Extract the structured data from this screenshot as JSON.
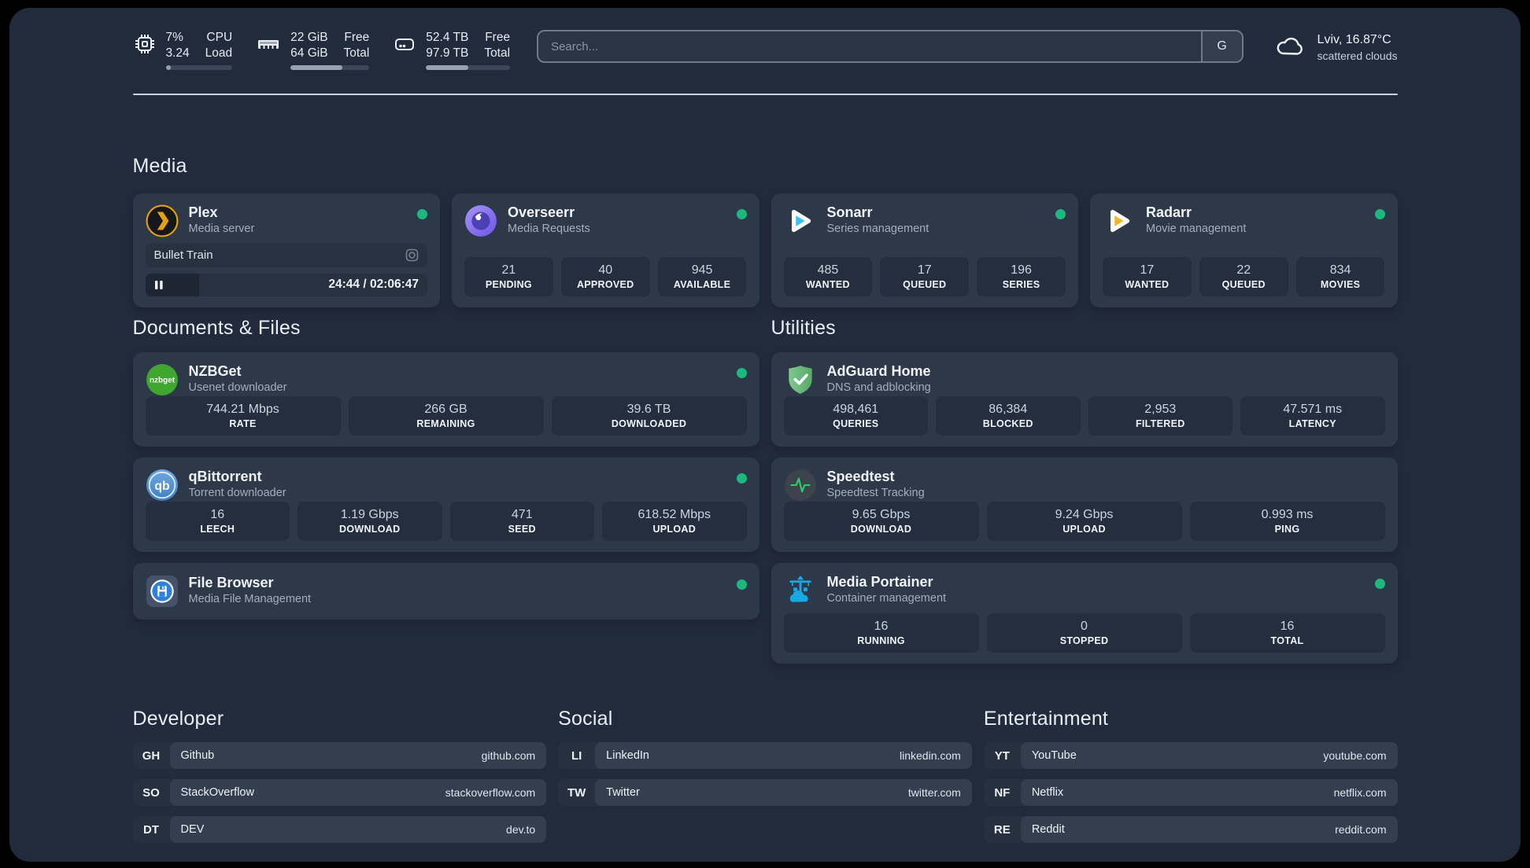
{
  "colors": {
    "status_online": "#1db87e",
    "plex_amber": "#e5a00d",
    "sonarr_cyan": "#35c5f4",
    "radarr_amber": "#f5b32a",
    "nzbget_green": "#3fa62e",
    "qbittorrent_blue": "#5b9bd5",
    "filebrowser_blue": "#2f80d8",
    "adguard_green": "#67b87a",
    "speedtest_green": "#2ecc71",
    "portainer_blue": "#18a9e2"
  },
  "topbar": {
    "cpu": {
      "line1_value": "7%",
      "line2_value": "3.24",
      "line1_label": "CPU",
      "line2_label": "Load",
      "progress": 8
    },
    "memory": {
      "line1_value": "22 GiB",
      "line2_value": "64 GiB",
      "line1_label": "Free",
      "line2_label": "Total",
      "progress": 66
    },
    "disk": {
      "line1_value": "52.4 TB",
      "line2_value": "97.9 TB",
      "line1_label": "Free",
      "line2_label": "Total",
      "progress": 50
    },
    "search": {
      "placeholder": "Search...",
      "button_label": "G"
    },
    "weather": {
      "location": "Lviv, 16.87°C",
      "condition": "scattered clouds"
    }
  },
  "media": {
    "title": "Media",
    "plex": {
      "name": "Plex",
      "subtitle": "Media server",
      "status": "online",
      "now_playing": {
        "title": "Bullet Train",
        "time_display": "24:44 / 02:06:47",
        "state": "paused",
        "progress": 19
      }
    },
    "overseerr": {
      "name": "Overseerr",
      "subtitle": "Media Requests",
      "status": "online",
      "stats": [
        {
          "value": "21",
          "label": "PENDING"
        },
        {
          "value": "40",
          "label": "APPROVED"
        },
        {
          "value": "945",
          "label": "AVAILABLE"
        }
      ]
    },
    "sonarr": {
      "name": "Sonarr",
      "subtitle": "Series management",
      "status": "online",
      "stats": [
        {
          "value": "485",
          "label": "WANTED"
        },
        {
          "value": "17",
          "label": "QUEUED"
        },
        {
          "value": "196",
          "label": "SERIES"
        }
      ]
    },
    "radarr": {
      "name": "Radarr",
      "subtitle": "Movie management",
      "status": "online",
      "stats": [
        {
          "value": "17",
          "label": "WANTED"
        },
        {
          "value": "22",
          "label": "QUEUED"
        },
        {
          "value": "834",
          "label": "MOVIES"
        }
      ]
    }
  },
  "documents": {
    "title": "Documents & Files",
    "nzbget": {
      "name": "NZBGet",
      "subtitle": "Usenet downloader",
      "status": "online",
      "stats": [
        {
          "value": "744.21 Mbps",
          "label": "RATE"
        },
        {
          "value": "266 GB",
          "label": "REMAINING"
        },
        {
          "value": "39.6 TB",
          "label": "DOWNLOADED"
        }
      ]
    },
    "qbittorrent": {
      "name": "qBittorrent",
      "subtitle": "Torrent downloader",
      "status": "online",
      "stats": [
        {
          "value": "16",
          "label": "LEECH"
        },
        {
          "value": "1.19 Gbps",
          "label": "DOWNLOAD"
        },
        {
          "value": "471",
          "label": "SEED"
        },
        {
          "value": "618.52 Mbps",
          "label": "UPLOAD"
        }
      ]
    },
    "filebrowser": {
      "name": "File Browser",
      "subtitle": "Media File Management",
      "status": "online"
    }
  },
  "utilities": {
    "title": "Utilities",
    "adguard": {
      "name": "AdGuard Home",
      "subtitle": "DNS and adblocking",
      "stats": [
        {
          "value": "498,461",
          "label": "QUERIES"
        },
        {
          "value": "86,384",
          "label": "BLOCKED"
        },
        {
          "value": "2,953",
          "label": "FILTERED"
        },
        {
          "value": "47.571 ms",
          "label": "LATENCY"
        }
      ]
    },
    "speedtest": {
      "name": "Speedtest",
      "subtitle": "Speedtest Tracking",
      "stats": [
        {
          "value": "9.65 Gbps",
          "label": "DOWNLOAD"
        },
        {
          "value": "9.24 Gbps",
          "label": "UPLOAD"
        },
        {
          "value": "0.993 ms",
          "label": "PING"
        }
      ]
    },
    "portainer": {
      "name": "Media Portainer",
      "subtitle": "Container management",
      "status": "online",
      "stats": [
        {
          "value": "16",
          "label": "RUNNING"
        },
        {
          "value": "0",
          "label": "STOPPED"
        },
        {
          "value": "16",
          "label": "TOTAL"
        }
      ]
    }
  },
  "link_groups": [
    {
      "title": "Developer",
      "links": [
        {
          "abbr": "GH",
          "name": "Github",
          "url": "github.com"
        },
        {
          "abbr": "SO",
          "name": "StackOverflow",
          "url": "stackoverflow.com"
        },
        {
          "abbr": "DT",
          "name": "DEV",
          "url": "dev.to"
        }
      ]
    },
    {
      "title": "Social",
      "links": [
        {
          "abbr": "LI",
          "name": "LinkedIn",
          "url": "linkedin.com"
        },
        {
          "abbr": "TW",
          "name": "Twitter",
          "url": "twitter.com"
        }
      ]
    },
    {
      "title": "Entertainment",
      "links": [
        {
          "abbr": "YT",
          "name": "YouTube",
          "url": "youtube.com"
        },
        {
          "abbr": "NF",
          "name": "Netflix",
          "url": "netflix.com"
        },
        {
          "abbr": "RE",
          "name": "Reddit",
          "url": "reddit.com"
        }
      ]
    }
  ]
}
